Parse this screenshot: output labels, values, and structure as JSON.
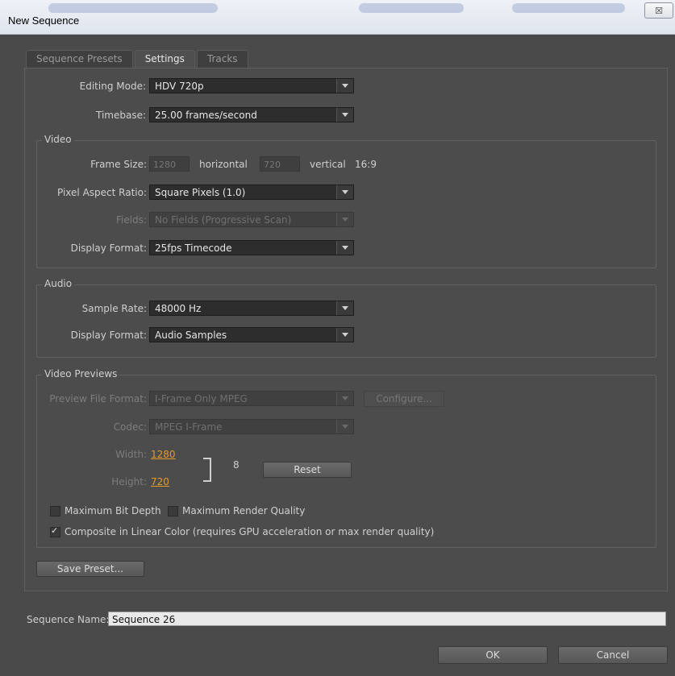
{
  "window": {
    "title": "New Sequence",
    "close_glyph": "☒"
  },
  "tabs": [
    {
      "label": "Sequence Presets",
      "active": false
    },
    {
      "label": "Settings",
      "active": true
    },
    {
      "label": "Tracks",
      "active": false
    }
  ],
  "general": {
    "editing_mode_label": "Editing Mode:",
    "editing_mode_value": "HDV 720p",
    "timebase_label": "Timebase:",
    "timebase_value": "25.00 frames/second"
  },
  "video": {
    "group_title": "Video",
    "frame_size_label": "Frame Size:",
    "frame_width": "1280",
    "horizontal_label": "horizontal",
    "frame_height": "720",
    "vertical_label": "vertical",
    "aspect": "16:9",
    "pixel_aspect_label": "Pixel Aspect Ratio:",
    "pixel_aspect_value": "Square Pixels (1.0)",
    "fields_label": "Fields:",
    "fields_value": "No Fields (Progressive Scan)",
    "display_format_label": "Display Format:",
    "display_format_value": "25fps Timecode"
  },
  "audio": {
    "group_title": "Audio",
    "sample_rate_label": "Sample Rate:",
    "sample_rate_value": "48000 Hz",
    "display_format_label": "Display Format:",
    "display_format_value": "Audio Samples"
  },
  "previews": {
    "group_title": "Video Previews",
    "file_format_label": "Preview File Format:",
    "file_format_value": "I-Frame Only MPEG",
    "configure_label": "Configure...",
    "codec_label": "Codec:",
    "codec_value": "MPEG I-Frame",
    "width_label": "Width:",
    "width_value": "1280",
    "height_label": "Height:",
    "height_value": "720",
    "link_glyph": "8",
    "reset_label": "Reset",
    "max_bit_depth_label": "Maximum Bit Depth",
    "max_bit_depth_checked": false,
    "max_render_quality_label": "Maximum Render Quality",
    "max_render_quality_checked": false,
    "linear_color_label": "Composite in Linear Color (requires GPU acceleration or max render quality)",
    "linear_color_checked": true
  },
  "save_preset_label": "Save Preset...",
  "sequence_name": {
    "label": "Sequence Name:",
    "value": "Sequence 26"
  },
  "footer": {
    "ok_label": "OK",
    "cancel_label": "Cancel"
  }
}
